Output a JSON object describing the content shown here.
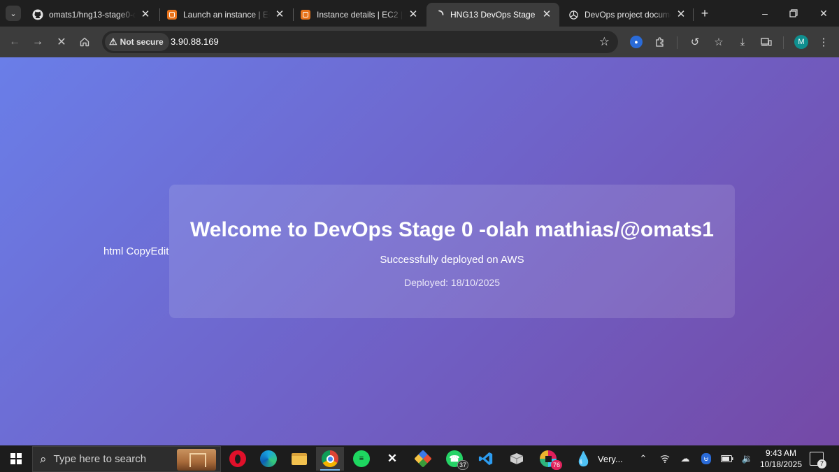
{
  "browser": {
    "tabs": [
      {
        "title": "omats1/hng13-stage0-de",
        "favicon": "github-icon",
        "active": false
      },
      {
        "title": "Launch an instance | EC2",
        "favicon": "aws-icon",
        "active": false
      },
      {
        "title": "Instance details | EC2 | us",
        "favicon": "aws-icon",
        "active": false
      },
      {
        "title": "HNG13 DevOps Stage 0",
        "favicon": "loading-spinner-icon",
        "active": true
      },
      {
        "title": "DevOps project documen",
        "favicon": "chatgpt-icon",
        "active": false
      }
    ],
    "security_label": "Not secure",
    "url": "3.90.88.169",
    "profile_initial": "M"
  },
  "page": {
    "stray_text": "html CopyEdit",
    "title": "Welcome to DevOps Stage 0 -olah mathias/@omats1",
    "subtitle": "Successfully deployed on AWS",
    "deployed": "Deployed: 18/10/2025",
    "gradient_colors": [
      "#6a7ee8",
      "#7449a6"
    ]
  },
  "taskbar": {
    "search_placeholder": "Type here to search",
    "apps": [
      {
        "name": "opera-icon",
        "badge": ""
      },
      {
        "name": "edge-icon",
        "badge": ""
      },
      {
        "name": "file-explorer-icon",
        "badge": ""
      },
      {
        "name": "chrome-icon",
        "badge": "",
        "active": true
      },
      {
        "name": "spotify-icon",
        "badge": ""
      },
      {
        "name": "x-icon",
        "badge": ""
      },
      {
        "name": "git-icon",
        "badge": ""
      },
      {
        "name": "whatsapp-icon",
        "badge": "37"
      },
      {
        "name": "vscode-icon",
        "badge": ""
      },
      {
        "name": "box-app-icon",
        "badge": ""
      },
      {
        "name": "slack-icon",
        "badge": "76"
      }
    ],
    "weather_label": "Very...",
    "time": "9:43 AM",
    "date": "10/18/2025",
    "notification_count": "7"
  }
}
